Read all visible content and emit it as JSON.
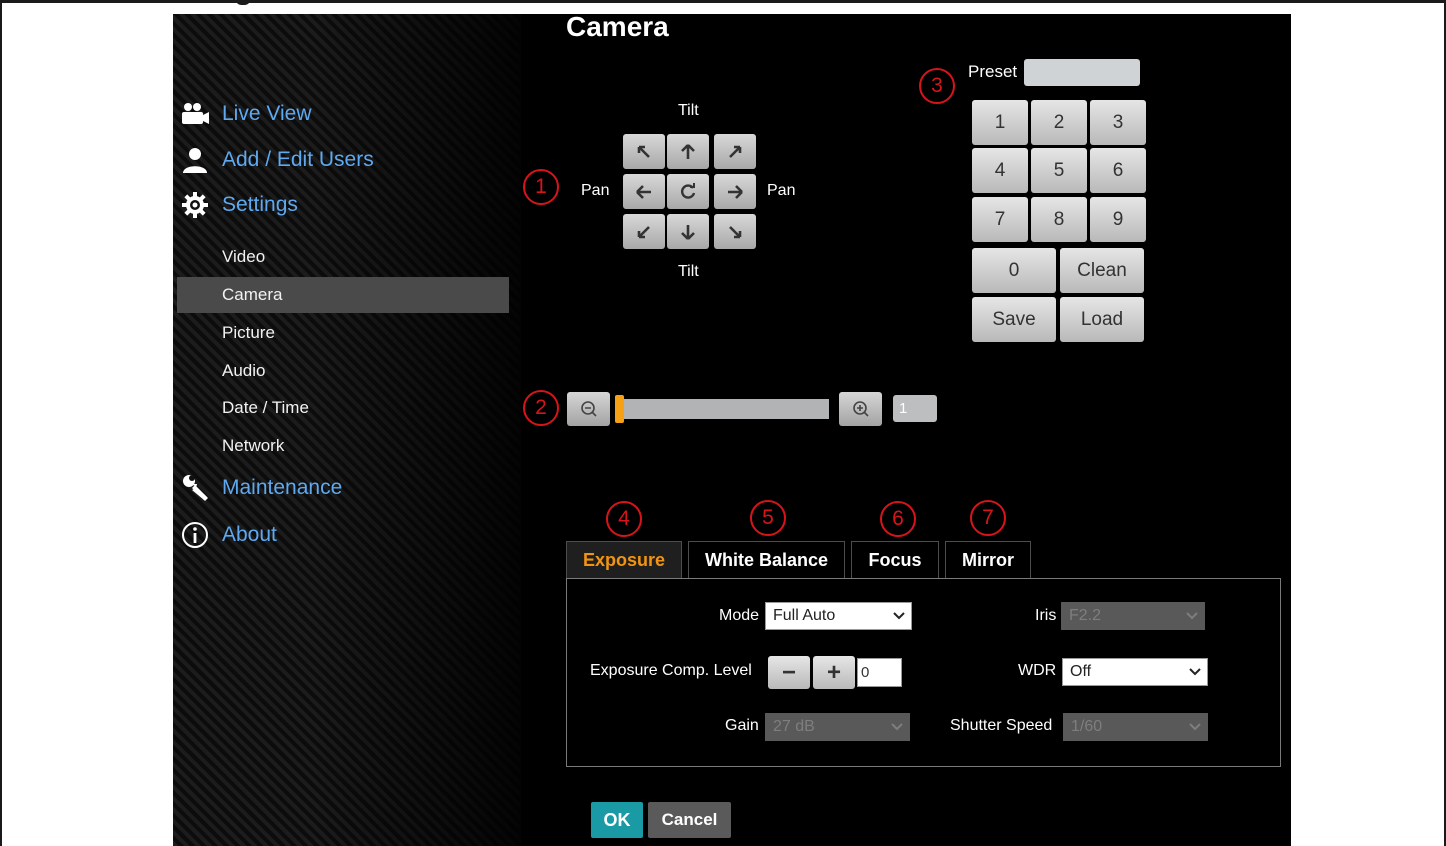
{
  "page": {
    "title": "Camera"
  },
  "sidebar": {
    "main": [
      {
        "label": "Live View",
        "icon": "video-camera-icon"
      },
      {
        "label": "Add / Edit Users",
        "icon": "user-icon"
      },
      {
        "label": "Settings",
        "icon": "gear-icon"
      }
    ],
    "settings_items": [
      "Video",
      "Camera",
      "Picture",
      "Audio",
      "Date / Time",
      "Network"
    ],
    "active_item": "Camera",
    "bottom": [
      {
        "label": "Maintenance",
        "icon": "wrench-icon"
      },
      {
        "label": "About",
        "icon": "info-icon"
      }
    ]
  },
  "callouts": [
    "1",
    "2",
    "3",
    "4",
    "5",
    "6",
    "7"
  ],
  "ptz": {
    "tilt_label": "Tilt",
    "pan_label": "Pan",
    "buttons": [
      "up-left-arrow-icon",
      "up-arrow-icon",
      "up-right-arrow-icon",
      "left-arrow-icon",
      "home-icon",
      "right-arrow-icon",
      "down-left-arrow-icon",
      "down-arrow-icon",
      "down-right-arrow-icon"
    ]
  },
  "preset": {
    "label": "Preset",
    "value": "",
    "keys": [
      "1",
      "2",
      "3",
      "4",
      "5",
      "6",
      "7",
      "8",
      "9"
    ],
    "zero": "0",
    "clean": "Clean",
    "save": "Save",
    "load": "Load"
  },
  "zoom": {
    "value": "1",
    "level": 0.0
  },
  "tabs": [
    "Exposure",
    "White Balance",
    "Focus",
    "Mirror"
  ],
  "active_tab": "Exposure",
  "exposure": {
    "mode_label": "Mode",
    "mode_value": "Full Auto",
    "iris_label": "Iris",
    "iris_value": "F2.2",
    "comp_label": "Exposure Comp. Level",
    "comp_minus": "−",
    "comp_plus": "+",
    "comp_value": "0",
    "wdr_label": "WDR",
    "wdr_value": "Off",
    "gain_label": "Gain",
    "gain_value": "27 dB",
    "shutter_label": "Shutter Speed",
    "shutter_value": "1/60"
  },
  "actions": {
    "ok": "OK",
    "cancel": "Cancel"
  },
  "colors": {
    "accent": "#f29412",
    "callout": "#d8141b",
    "nav_link": "#5ea9f0",
    "ok_button": "#1a9aa5"
  }
}
